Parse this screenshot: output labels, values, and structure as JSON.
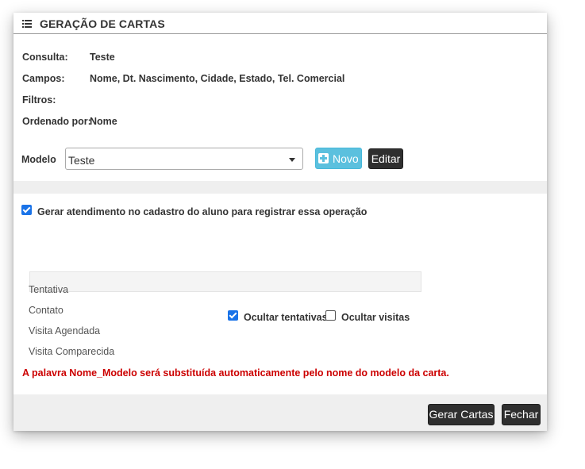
{
  "header": {
    "title": "GERAÇÃO DE CARTAS",
    "icon": "list-icon"
  },
  "info": {
    "consulta_label": "Consulta:",
    "consulta_value": "Teste",
    "campos_label": "Campos:",
    "campos_value": "Nome, Dt. Nascimento, Cidade, Estado, Tel. Comercial",
    "filtros_label": "Filtros:",
    "filtros_value": "",
    "ordenado_label": "Ordenado por:",
    "ordenado_value": "Nome"
  },
  "modelo": {
    "label": "Modelo",
    "selected": "Teste"
  },
  "buttons": {
    "novo": "Novo",
    "editar": "Editar",
    "gerar": "Gerar Cartas",
    "fechar": "Fechar"
  },
  "options": {
    "gerar_atendimento": "Gerar atendimento no cadastro do aluno para registrar essa operação",
    "ocultar_tentativas": "Ocultar tentativas",
    "ocultar_visitas": "Ocultar visitas"
  },
  "status_list": [
    "Tentativa",
    "Contato",
    "Visita Agendada",
    "Visita Comparecida"
  ],
  "note": "A palavra Nome_Modelo será substituída automaticamente pelo nome do modelo da carta.",
  "colors": {
    "info_button": "#5bc0de",
    "dark_button": "#2f2f2f",
    "note": "#cc0000",
    "checkbox": "#1a73e8"
  }
}
